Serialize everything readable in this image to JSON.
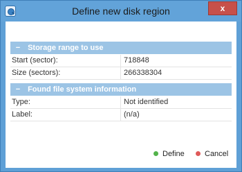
{
  "window": {
    "title": "Define new disk region",
    "close_glyph": "x"
  },
  "sections": [
    {
      "collapse_glyph": "−",
      "title": "Storage range to use",
      "rows": [
        {
          "key": "Start (sector):",
          "value": "718848"
        },
        {
          "key": "Size (sectors):",
          "value": "266338304"
        }
      ]
    },
    {
      "collapse_glyph": "−",
      "title": "Found file system information",
      "rows": [
        {
          "key": "Type:",
          "value": "Not identified"
        },
        {
          "key": "Label:",
          "value": "(n/a)"
        }
      ]
    }
  ],
  "buttons": {
    "define_label": "Define",
    "cancel_label": "Cancel"
  },
  "colors": {
    "accent": "#62a3d9",
    "section_header": "#9cc4e5",
    "define_dot": "#53b34b",
    "cancel_dot": "#df5a59",
    "close_button": "#c7504a"
  },
  "icons": {
    "app": "disk-region-app-icon",
    "close": "close-icon",
    "collapse": "collapse-minus-icon"
  }
}
